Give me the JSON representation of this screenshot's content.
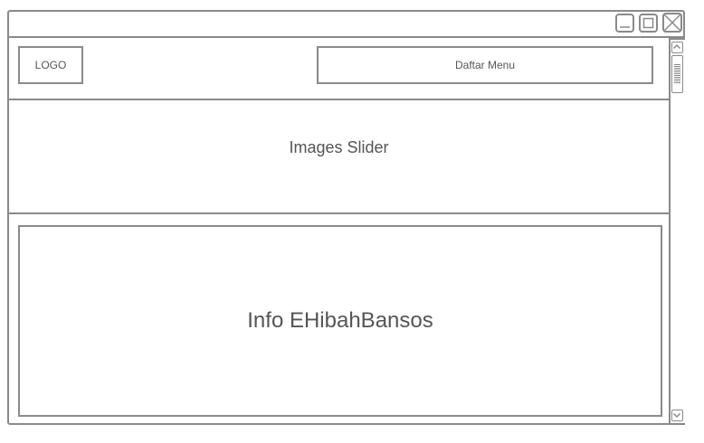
{
  "window": {
    "controls": {
      "minimize_icon": "minimize-icon",
      "maximize_icon": "maximize-icon",
      "close_icon": "close-icon"
    }
  },
  "header": {
    "logo_label": "LOGO",
    "menu_label": "Daftar Menu"
  },
  "slider": {
    "label": "Images Slider"
  },
  "info": {
    "label": "Info EHibahBansos"
  },
  "scrollbar": {
    "up_icon": "chevron-up-icon",
    "down_icon": "chevron-down-icon"
  },
  "colors": {
    "border": "#8a8a8a",
    "text": "#555555",
    "background": "#ffffff"
  }
}
